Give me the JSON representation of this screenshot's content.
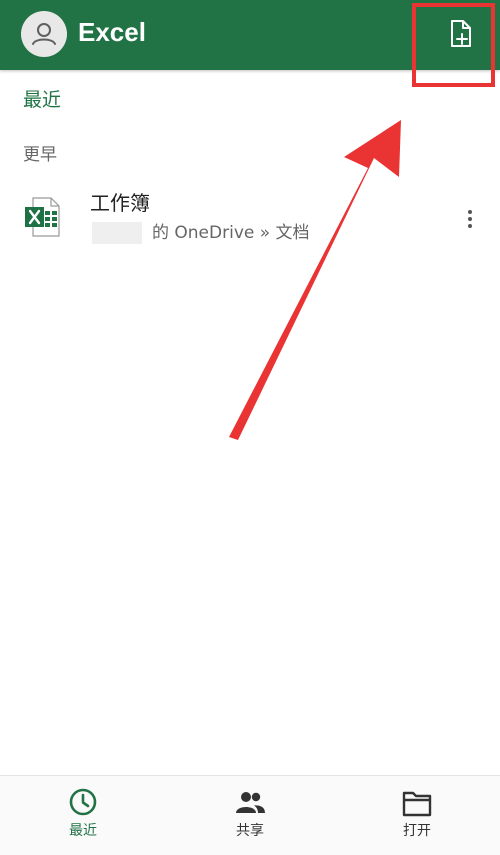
{
  "header": {
    "title": "Excel",
    "avatar_icon": "person-icon",
    "new_file_icon": "new-file-icon",
    "background_color": "#217346"
  },
  "recent": {
    "section_title": "最近",
    "group_label": "更早",
    "files": [
      {
        "name": "工作簿",
        "location": "的 OneDrive » 文档",
        "icon": "excel-file-icon"
      }
    ]
  },
  "bottom_nav": {
    "items": [
      {
        "label": "最近",
        "icon": "clock-icon",
        "active": true
      },
      {
        "label": "共享",
        "icon": "people-icon",
        "active": false
      },
      {
        "label": "打开",
        "icon": "folder-icon",
        "active": false
      }
    ]
  },
  "annotation": {
    "color": "#ea3333"
  }
}
